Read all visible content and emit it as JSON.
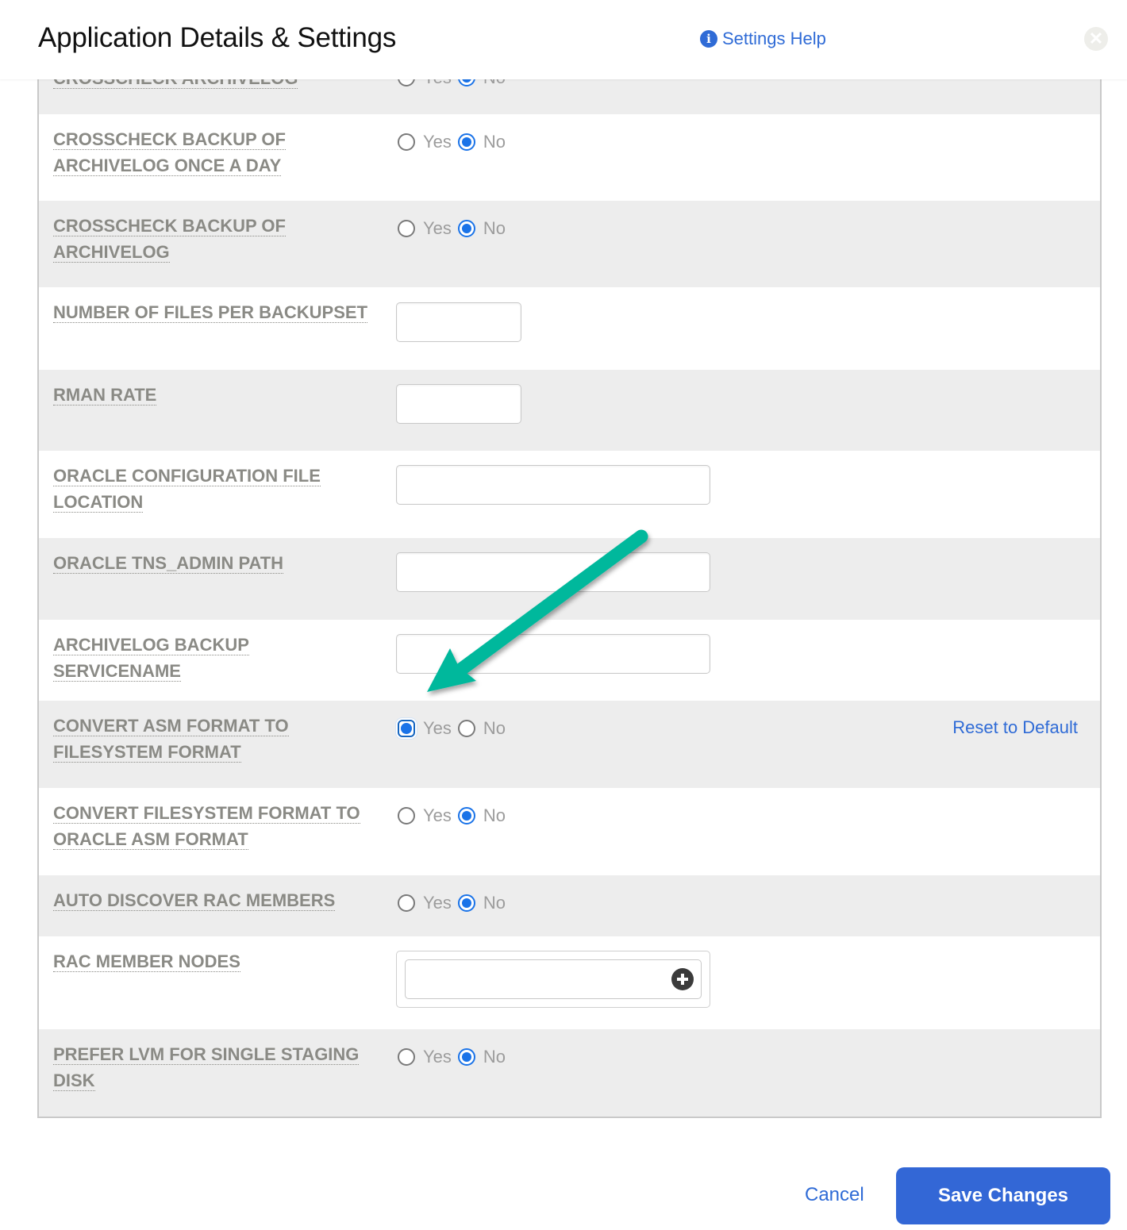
{
  "header": {
    "title": "Application Details & Settings",
    "help_label": "Settings Help",
    "help_icon": "info-circle-icon",
    "close_icon": "close-icon"
  },
  "settings": [
    {
      "label": "CROSSCHECK ARCHIVELOG",
      "type": "radio",
      "yes": "Yes",
      "no": "No",
      "value": "No",
      "partial": true
    },
    {
      "label": "CROSSCHECK BACKUP OF ARCHIVELOG ONCE A DAY",
      "type": "radio",
      "yes": "Yes",
      "no": "No",
      "value": "No"
    },
    {
      "label": "CROSSCHECK BACKUP OF ARCHIVELOG",
      "type": "radio",
      "yes": "Yes",
      "no": "No",
      "value": "No"
    },
    {
      "label": "NUMBER OF FILES PER BACKUPSET",
      "type": "text",
      "value": ""
    },
    {
      "label": "RMAN RATE",
      "type": "text",
      "value": ""
    },
    {
      "label": "ORACLE CONFIGURATION FILE LOCATION",
      "type": "text",
      "value": ""
    },
    {
      "label": "ORACLE TNS_ADMIN PATH",
      "type": "text",
      "value": ""
    },
    {
      "label": "ARCHIVELOG BACKUP SERVICENAME",
      "type": "text",
      "value": ""
    },
    {
      "label": "CONVERT ASM FORMAT TO FILESYSTEM FORMAT",
      "type": "radio",
      "yes": "Yes",
      "no": "No",
      "value": "Yes",
      "reset_label": "Reset to Default"
    },
    {
      "label": "CONVERT FILESYSTEM FORMAT TO ORACLE ASM FORMAT",
      "type": "radio",
      "yes": "Yes",
      "no": "No",
      "value": "No"
    },
    {
      "label": "AUTO DISCOVER RAC MEMBERS",
      "type": "radio",
      "yes": "Yes",
      "no": "No",
      "value": "No"
    },
    {
      "label": "RAC MEMBER NODES",
      "type": "tags",
      "value": "",
      "add_icon": "plus-circle-icon"
    },
    {
      "label": "PREFER LVM FOR SINGLE STAGING DISK",
      "type": "radio",
      "yes": "Yes",
      "no": "No",
      "value": "No"
    }
  ],
  "footer": {
    "cancel_label": "Cancel",
    "save_label": "Save Changes"
  },
  "annotation": {
    "type": "arrow",
    "color": "#00b89c",
    "points_to": "CONVERT ASM FORMAT TO FILESYSTEM FORMAT"
  },
  "colors": {
    "accent": "#2f6bd6",
    "save_button": "#3367d6",
    "label_gray": "#8a8a85",
    "row_alt": "#ededed"
  }
}
